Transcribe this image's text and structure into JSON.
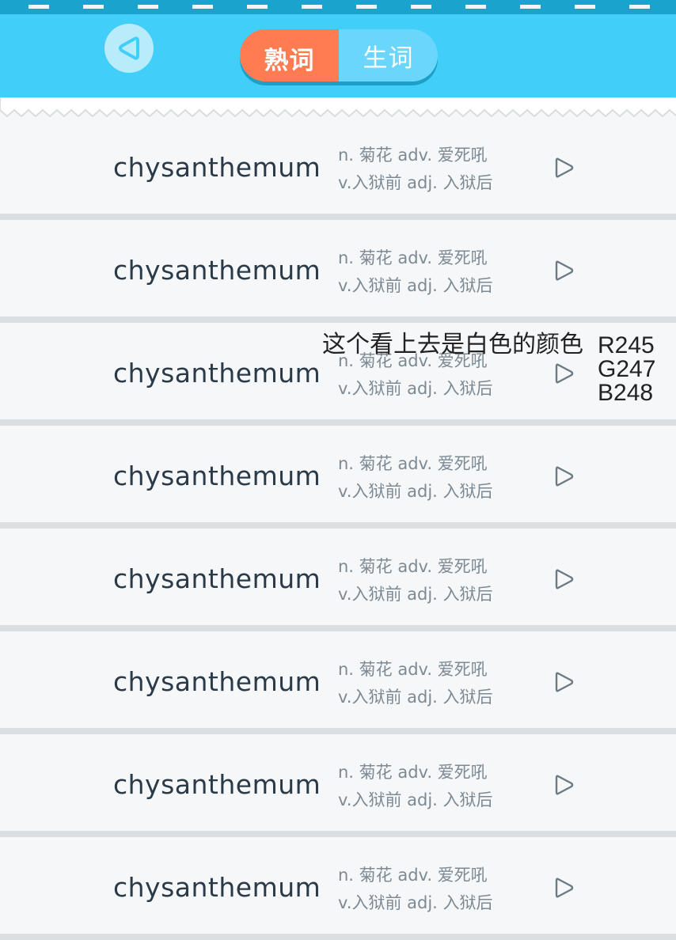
{
  "header": {
    "back_icon": "back-arrow-icon",
    "tabs": [
      {
        "label": "熟词",
        "active": true,
        "color": "#ff7c52"
      },
      {
        "label": "生词",
        "active": false,
        "color": "#6bd6fb"
      }
    ],
    "bg_color": "#41cef8"
  },
  "rows": [
    {
      "word": "chysanthemum",
      "def_line1": "n. 菊花   adv. 爱死吼",
      "def_line2": "v.入狱前  adj. 入狱后"
    },
    {
      "word": "chysanthemum",
      "def_line1": "n. 菊花   adv. 爱死吼",
      "def_line2": "v.入狱前  adj. 入狱后"
    },
    {
      "word": "chysanthemum",
      "def_line1": "n. 菊花   adv. 爱死吼",
      "def_line2": "v.入狱前  adj. 入狱后"
    },
    {
      "word": "chysanthemum",
      "def_line1": "n. 菊花   adv. 爱死吼",
      "def_line2": "v.入狱前  adj. 入狱后"
    },
    {
      "word": "chysanthemum",
      "def_line1": "n. 菊花   adv. 爱死吼",
      "def_line2": "v.入狱前  adj. 入狱后"
    },
    {
      "word": "chysanthemum",
      "def_line1": "n. 菊花   adv. 爱死吼",
      "def_line2": "v.入狱前  adj. 入狱后"
    },
    {
      "word": "chysanthemum",
      "def_line1": "n. 菊花   adv. 爱死吼",
      "def_line2": "v.入狱前  adj. 入狱后"
    },
    {
      "word": "chysanthemum",
      "def_line1": "n. 菊花   adv. 爱死吼",
      "def_line2": "v.入狱前  adj. 入狱后"
    }
  ],
  "annotation": {
    "text": "这个看上去是白色的颜色",
    "r": "R245",
    "g": "G247",
    "b": "B248"
  }
}
